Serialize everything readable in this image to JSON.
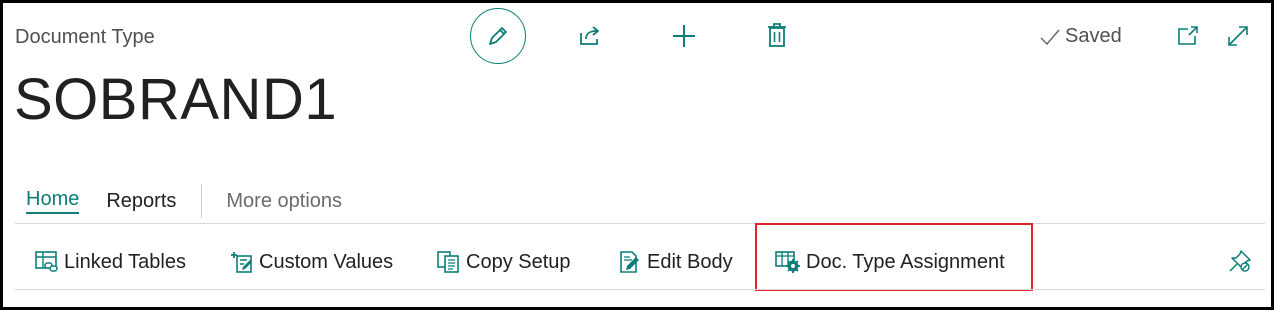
{
  "header": {
    "page_type": "Document Type",
    "record_title": "SOBRAND1",
    "saved_label": "Saved",
    "icons": {
      "edit": "pencil-icon",
      "share": "share-icon",
      "new": "plus-icon",
      "delete": "trash-icon",
      "saved": "checkmark-icon",
      "popout": "open-new-window-icon",
      "expand": "expand-icon"
    }
  },
  "tabs": [
    {
      "label": "Home",
      "active": true
    },
    {
      "label": "Reports",
      "active": false
    },
    {
      "label": "More options",
      "active": false
    }
  ],
  "actions": [
    {
      "label": "Linked Tables",
      "icon": "linked-tables-icon"
    },
    {
      "label": "Custom Values",
      "icon": "custom-values-icon"
    },
    {
      "label": "Copy Setup",
      "icon": "copy-setup-icon"
    },
    {
      "label": "Edit Body",
      "icon": "edit-body-icon"
    },
    {
      "label": "Doc. Type Assignment",
      "icon": "doc-type-assignment-icon",
      "highlighted": true
    }
  ],
  "pin_icon": "pin-icon",
  "colors": {
    "accent": "#0b7f77",
    "highlight_border": "#e0242c",
    "text": "#212121",
    "muted": "#505050"
  }
}
